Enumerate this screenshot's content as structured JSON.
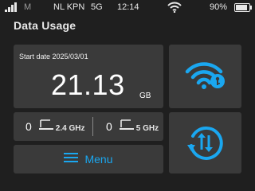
{
  "status_bar": {
    "mobile_signal_icon": "signal-bars-icon",
    "sim_label": "M",
    "carrier": "NL KPN",
    "network_type": "5G",
    "time": "12:14",
    "wifi_icon": "wifi-icon",
    "battery_percent": "90%",
    "battery_level": 0.9
  },
  "page": {
    "title": "Data Usage"
  },
  "usage": {
    "start_date_label": "Start date 2025/03/01",
    "amount": "21.13",
    "unit": "GB"
  },
  "bands": [
    {
      "count": "0",
      "label": "2.4 GHz",
      "icon": "laptop-icon"
    },
    {
      "count": "0",
      "label": "5 GHz",
      "icon": "laptop-icon"
    }
  ],
  "menu": {
    "label": "Menu",
    "icon": "hamburger-icon"
  },
  "actions": {
    "wifi_info_icon": "wifi-key-icon",
    "refresh_icon": "refresh-data-icon"
  },
  "colors": {
    "background": "#1f1f1f",
    "card": "#3a3a3a",
    "accent": "#1aa7f0",
    "text": "#ffffff"
  }
}
